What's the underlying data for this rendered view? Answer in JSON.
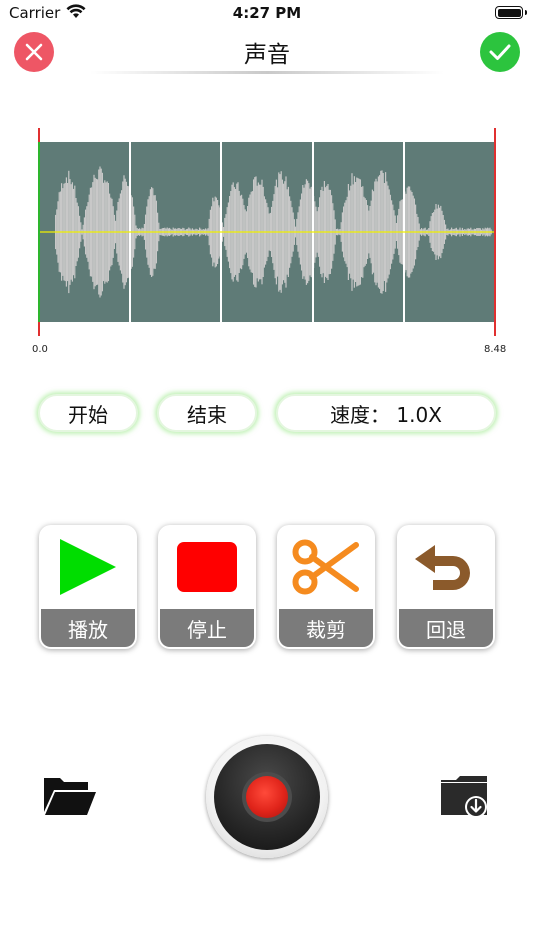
{
  "status_bar": {
    "carrier": "Carrier",
    "time": "4:27 PM",
    "battery_level": 1.0
  },
  "nav": {
    "title": "声音",
    "close_icon": "close-x-icon",
    "confirm_icon": "checkmark-icon",
    "close_color": "#ee5665",
    "confirm_color": "#2cc43e"
  },
  "waveform": {
    "start_label": "0.0",
    "end_label": "8.48",
    "background_color": "#5f7b77",
    "wave_color": "#c8c8c8",
    "center_line_color": "#f0f000",
    "start_marker_color": "#2db52d",
    "end_marker_color": "#e03030"
  },
  "controls": {
    "start_label": "开始",
    "end_label": "结束",
    "speed_label": "速度： 1.0X"
  },
  "actions": [
    {
      "label": "播放",
      "icon": "play-icon",
      "color": "#00dd00"
    },
    {
      "label": "停止",
      "icon": "stop-icon",
      "color": "#ff0000"
    },
    {
      "label": "裁剪",
      "icon": "scissors-icon",
      "color": "#f58b1f"
    },
    {
      "label": "回退",
      "icon": "undo-icon",
      "color": "#8b5a2b"
    }
  ],
  "bottom": {
    "open_folder_icon": "open-folder-icon",
    "record_icon": "record-icon",
    "save_folder_icon": "folder-download-icon"
  }
}
